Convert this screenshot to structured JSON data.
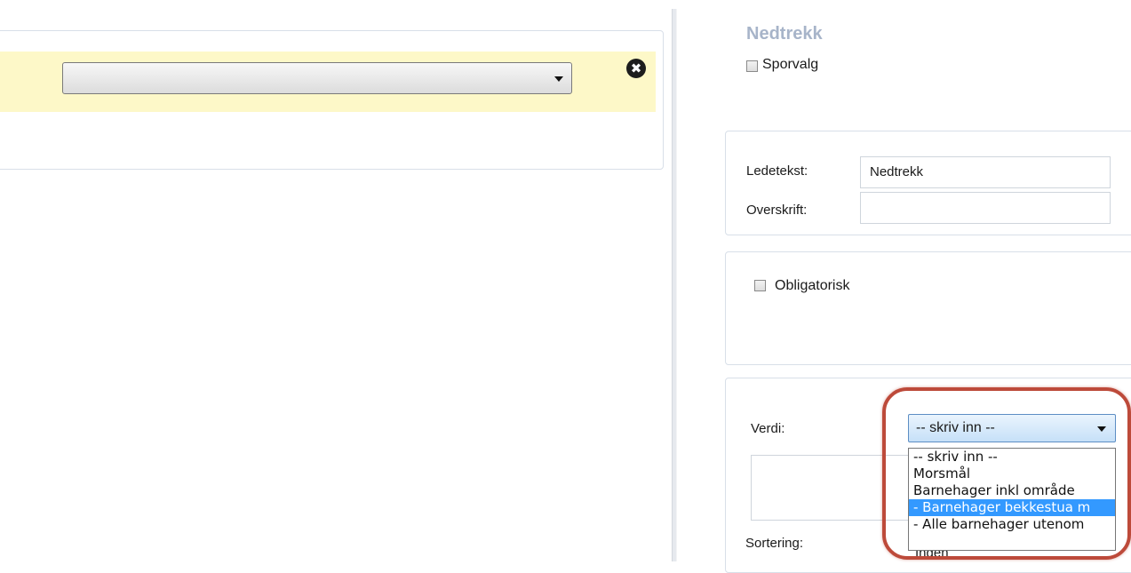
{
  "panel": {
    "title": "Nedtrekk",
    "sporvalg_label": "Sporvalg",
    "ledetekst_label": "Ledetekst:",
    "ledetekst_value": "Nedtrekk",
    "overskrift_label": "Overskrift:",
    "overskrift_value": "",
    "obligatorisk_label": "Obligatorisk",
    "verdi_label": "Verdi:",
    "verdi_selected": "-- skriv inn --",
    "verdi_options": [
      "-- skriv inn --",
      "Morsmål",
      "Barnehager inkl område",
      " - Barnehager bekkestua m",
      " - Alle barnehager utenom"
    ],
    "verdi_highlighted_index": 3,
    "sortering_label": "Sortering:",
    "sortering_value": "Ingen"
  },
  "left_form": {
    "select_value": ""
  },
  "icons": {
    "remove": "close-circle-icon",
    "select_arrow": "chevron-down-icon"
  },
  "colors": {
    "highlight_row": "#fdf8c8",
    "title": "#a7b4c9",
    "selection": "#3399ff",
    "annotation_ring": "#bd4a3a"
  }
}
